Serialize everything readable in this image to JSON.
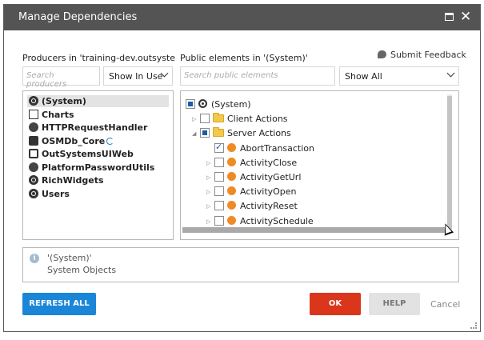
{
  "window": {
    "title": "Manage Dependencies",
    "close_label": "✕"
  },
  "producers": {
    "label": "Producers in 'training-dev.outsystems.n",
    "search_placeholder": "Search producers",
    "filter_value": "Show In Use",
    "items": [
      {
        "label": "(System)",
        "icon": "system-icon",
        "selected": true
      },
      {
        "label": "Charts",
        "icon": "chart-icon"
      },
      {
        "label": "HTTPRequestHandler",
        "icon": "extension-icon"
      },
      {
        "label": "OSMDb_Core",
        "icon": "database-icon"
      },
      {
        "label": "OutSystemsUIWeb",
        "icon": "webmodule-icon"
      },
      {
        "label": "PlatformPasswordUtils",
        "icon": "extension-icon"
      },
      {
        "label": "RichWidgets",
        "icon": "system-icon"
      },
      {
        "label": "Users",
        "icon": "system-icon"
      }
    ]
  },
  "public_elements": {
    "label": "Public elements in '(System)'",
    "search_placeholder": "Search public elements",
    "filter_value": "Show All",
    "tree": [
      {
        "label": "(System)",
        "level": 0,
        "state": "partial",
        "kind": "root"
      },
      {
        "label": "Client Actions",
        "level": 1,
        "state": "unchecked",
        "kind": "folder",
        "expander": "collapsed"
      },
      {
        "label": "Server Actions",
        "level": 1,
        "state": "partial",
        "kind": "folder",
        "expander": "expanded"
      },
      {
        "label": "AbortTransaction",
        "level": 2,
        "state": "checked",
        "kind": "action"
      },
      {
        "label": "ActivityClose",
        "level": 2,
        "state": "unchecked",
        "kind": "action",
        "expander": "collapsed"
      },
      {
        "label": "ActivityGetUrl",
        "level": 2,
        "state": "unchecked",
        "kind": "action",
        "expander": "collapsed"
      },
      {
        "label": "ActivityOpen",
        "level": 2,
        "state": "unchecked",
        "kind": "action",
        "expander": "collapsed"
      },
      {
        "label": "ActivityReset",
        "level": 2,
        "state": "unchecked",
        "kind": "action",
        "expander": "collapsed"
      },
      {
        "label": "ActivitySchedule",
        "level": 2,
        "state": "unchecked",
        "kind": "action",
        "expander": "collapsed"
      }
    ]
  },
  "feedback": {
    "label": "Submit Feedback"
  },
  "info": {
    "title": "'(System)'",
    "description": "System Objects"
  },
  "buttons": {
    "refresh_all": "REFRESH ALL",
    "ok": "OK",
    "help": "HELP",
    "cancel": "Cancel"
  },
  "colors": {
    "titlebar": "#545454",
    "primary": "#1b86d8",
    "ok": "#d9361c"
  }
}
